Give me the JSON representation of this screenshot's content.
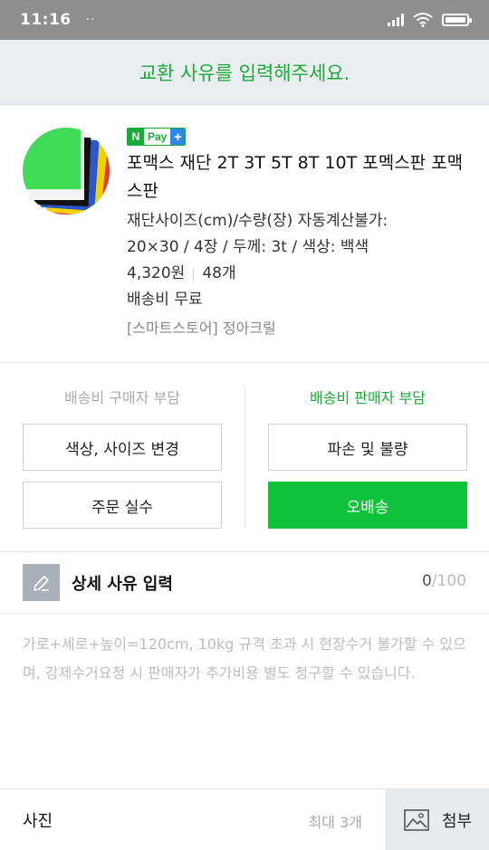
{
  "status_bar": {
    "time": "11:16",
    "dots": "··",
    "icons": [
      "signal-icon",
      "wifi-icon",
      "battery-icon"
    ]
  },
  "header": {
    "title": "교환 사유를 입력해주세요."
  },
  "product": {
    "badge": {
      "n": "N",
      "pay": "Pay",
      "plus": "+"
    },
    "title": "포맥스 재단 2T 3T 5T 8T 10T 포멕스판 포맥스판",
    "option_line1": "재단사이즈(cm)/수량(장) 자동계산불가:",
    "option_line2": "20×30 / 4장 / 두께: 3t / 색상: 백색",
    "price": "4,320원",
    "quantity": "48개",
    "shipping": "배송비 무료",
    "store": "[스마트스토어] 정아크릴"
  },
  "reasons": {
    "buyer_title": "배송비 구매자 부담",
    "seller_title": "배송비 판매자 부담",
    "buyer_options": [
      "색상, 사이즈 변경",
      "주문 실수"
    ],
    "seller_options": [
      "파손 및 불량",
      "오배송"
    ],
    "selected": "오배송"
  },
  "detail": {
    "title": "상세 사유 입력",
    "count": "0",
    "max": "/100",
    "value": "",
    "placeholder": "가로+세로+높이=120cm, 10kg 규격 초과 시 현장수거 불가할 수 있으며, 강제수거요청 시 판매자가 추가비용 별도 청구할 수 있습니다."
  },
  "photo": {
    "label": "사진",
    "max_text": "최대 3개",
    "attach_label": "첨부"
  },
  "colors": {
    "accent_green": "#1aaa39",
    "selected_button": "#10c23a",
    "npay_plus_blue": "#2d88e6",
    "header_bg": "#ebeef0",
    "status_bar_bg": "#8e8e8e"
  }
}
